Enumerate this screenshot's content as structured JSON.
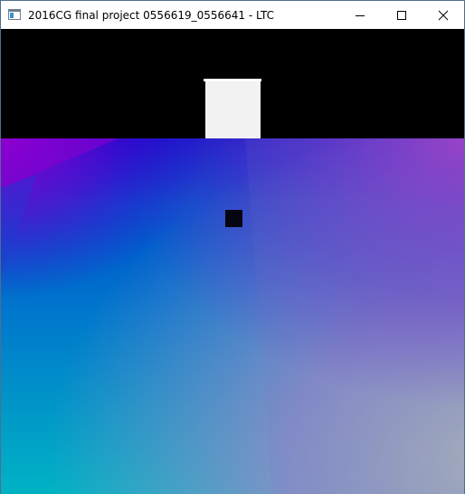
{
  "window": {
    "title": "2016CG final project 0556619_0556641 - LTC",
    "icon": "application-window-icon",
    "controls": {
      "minimize_icon": "minimize-icon",
      "maximize_icon": "maximize-icon",
      "close_icon": "close-icon"
    }
  },
  "scene": {
    "background_color": "#000000",
    "light_color": "#f2f2f2",
    "floor_colors": {
      "near_left": "#00b3c4",
      "near_right": "#9aa7b5",
      "far_left": "#8a00cf",
      "far_center": "#0010cc",
      "far_right": "#9a3ec6",
      "mid": "#0070cf"
    },
    "shadow_color": "#05060f"
  }
}
